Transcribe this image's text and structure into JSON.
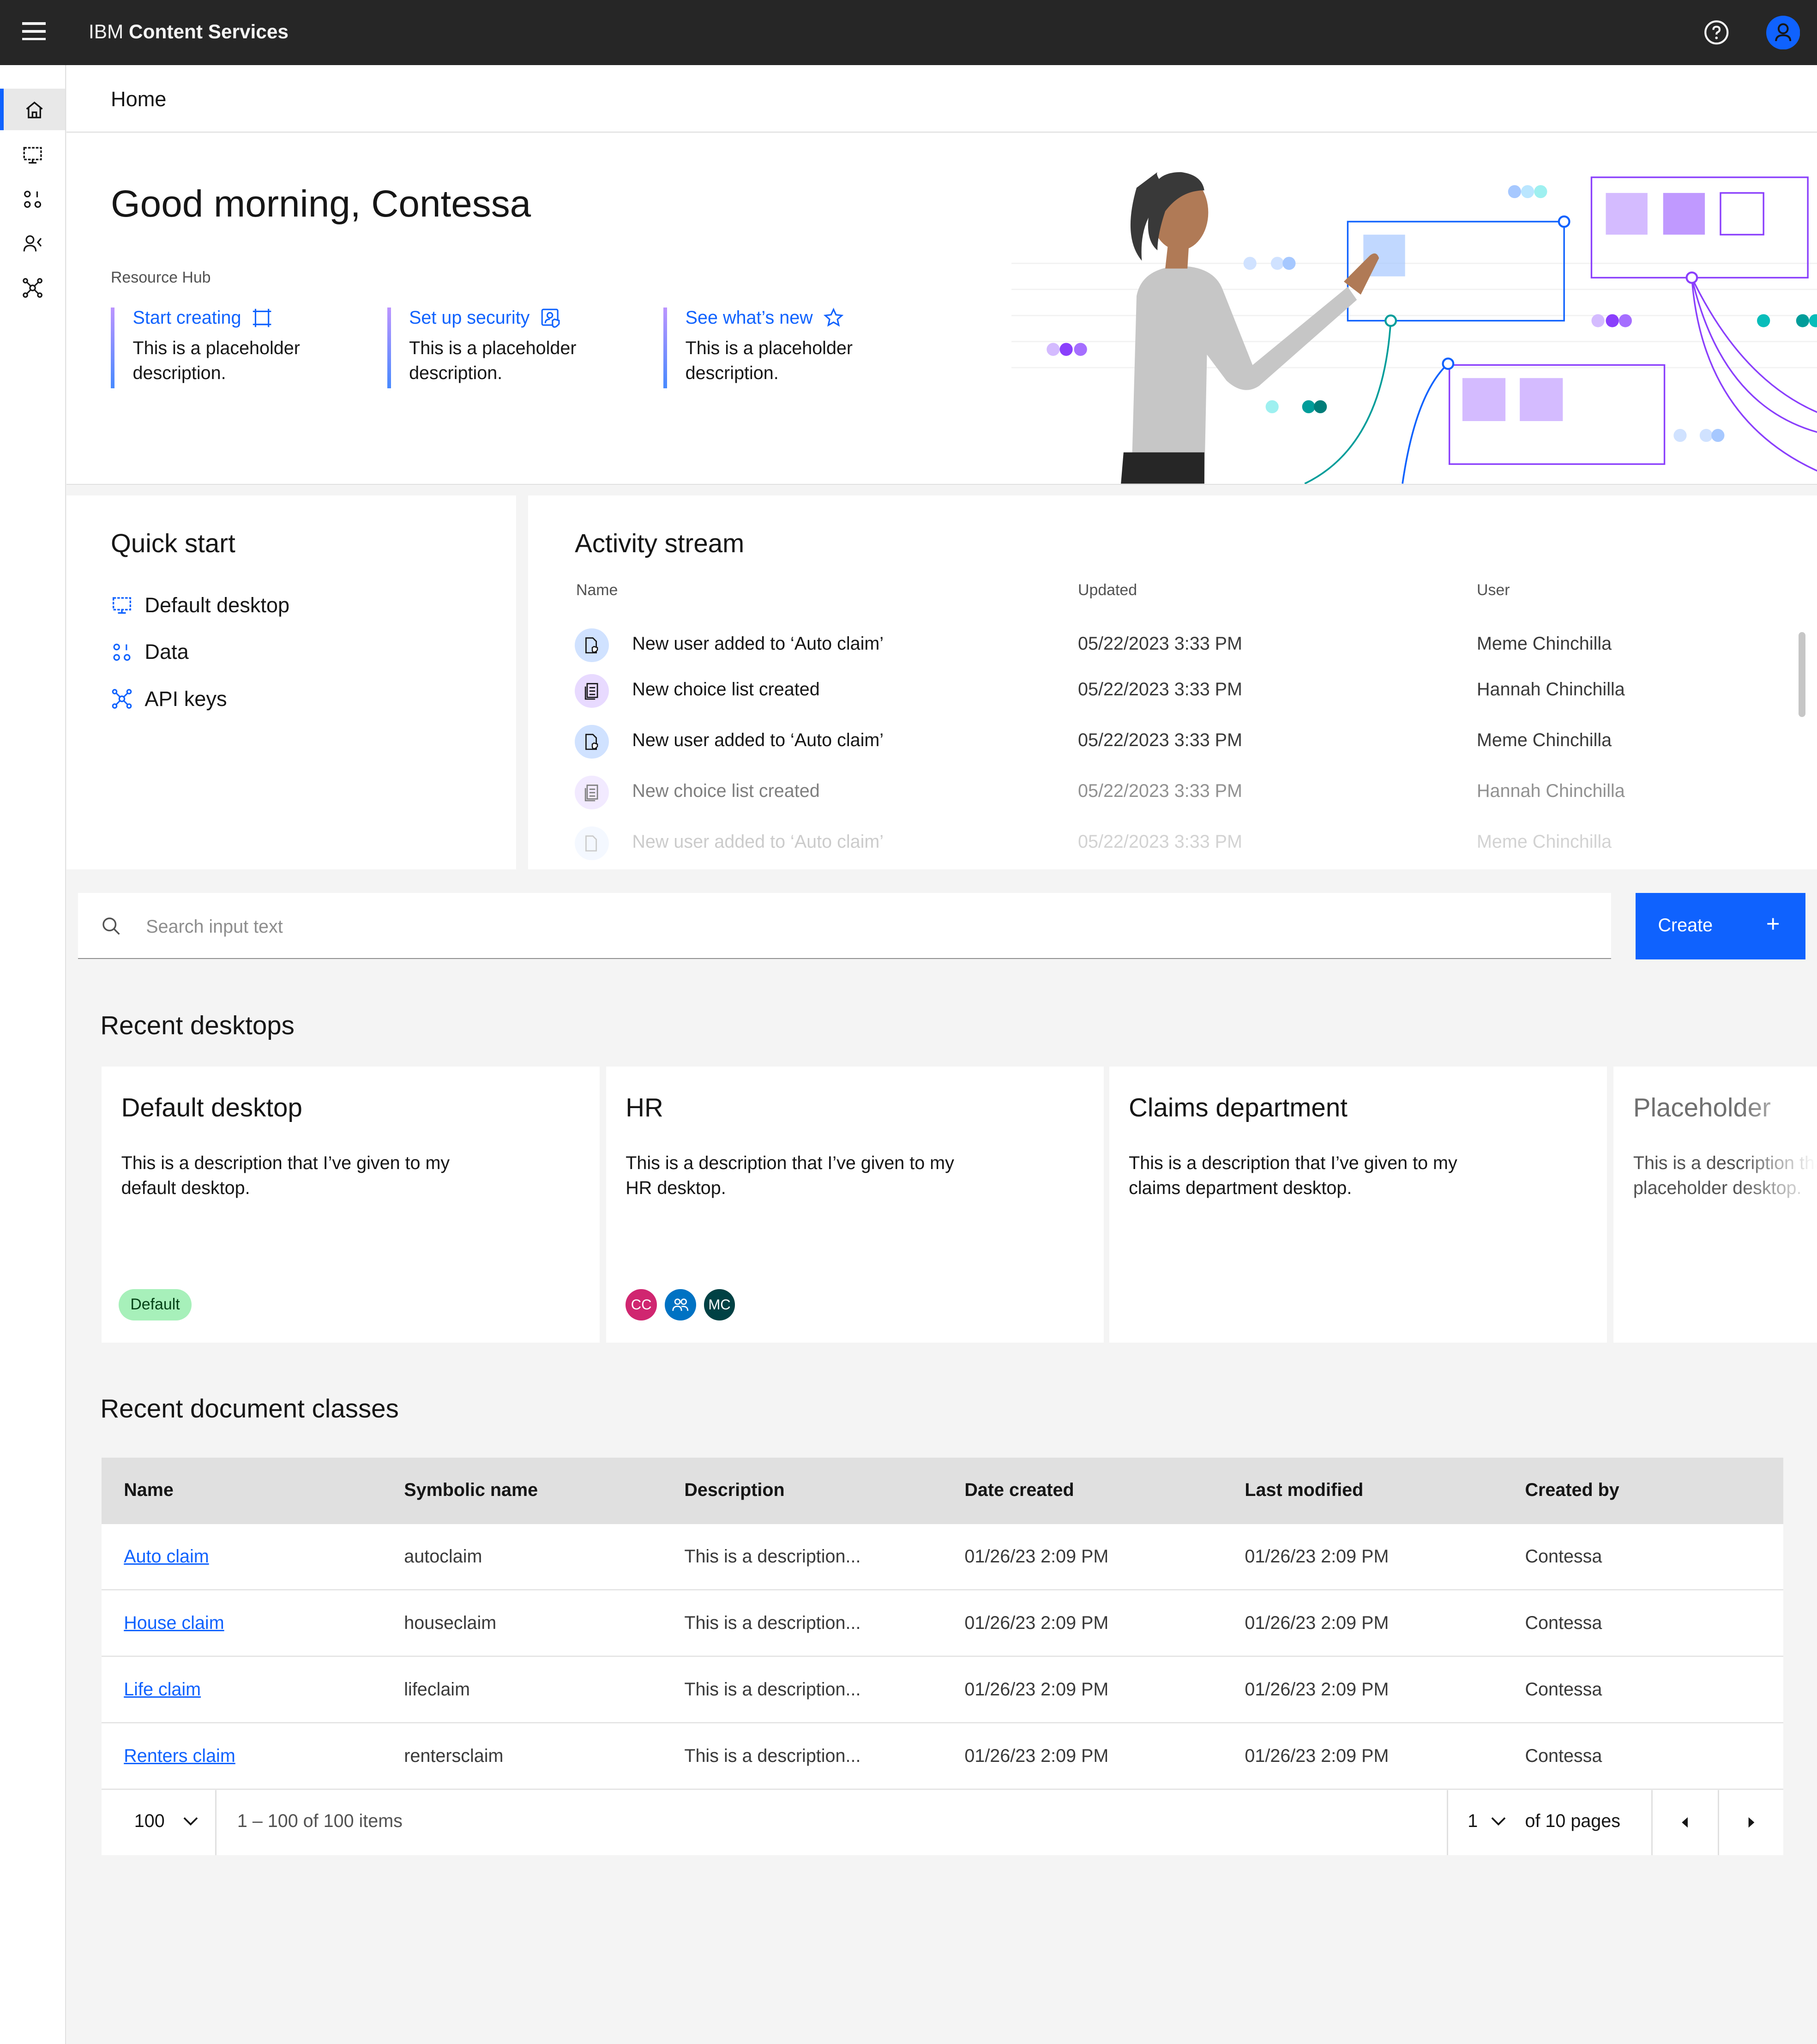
{
  "topbar": {
    "brand_prefix": "IBM",
    "brand_name": "Content Services"
  },
  "header": {
    "title": "Home"
  },
  "hero": {
    "greeting": "Good morning, Contessa",
    "hub_label": "Resource Hub",
    "resources": [
      {
        "title": "Start creating",
        "icon": "build-icon",
        "desc": "This is a placeholder description."
      },
      {
        "title": "Set up security",
        "icon": "user-security-icon",
        "desc": "This is a placeholder description."
      },
      {
        "title": "See what’s new",
        "icon": "star-icon",
        "desc": "This is a placeholder description."
      }
    ]
  },
  "quick_start": {
    "title": "Quick start",
    "items": [
      {
        "label": "Default desktop",
        "icon": "desktop-icon"
      },
      {
        "label": "Data",
        "icon": "data-icon"
      },
      {
        "label": "API keys",
        "icon": "api-icon"
      }
    ]
  },
  "activity": {
    "title": "Activity stream",
    "columns": {
      "name": "Name",
      "updated": "Updated",
      "user": "User"
    },
    "rows": [
      {
        "name": "New user added to ‘Auto claim’",
        "updated": "05/22/2023 3:33 PM",
        "user": "Meme Chinchilla",
        "icon": "document-security-icon"
      },
      {
        "name": "New choice list created",
        "updated": "05/22/2023 3:33 PM",
        "user": "Hannah Chinchilla",
        "icon": "list-document-icon"
      },
      {
        "name": "New user added to ‘Auto claim’",
        "updated": "05/22/2023 3:33 PM",
        "user": "Meme Chinchilla",
        "icon": "document-security-icon"
      },
      {
        "name": "New choice list created",
        "updated": "05/22/2023 3:33 PM",
        "user": "Hannah Chinchilla",
        "icon": "list-document-icon"
      },
      {
        "name": "New user added to ‘Auto claim’",
        "updated": "05/22/2023 3:33 PM",
        "user": "Meme Chinchilla",
        "icon": "document-security-icon"
      }
    ]
  },
  "search": {
    "placeholder": "Search input text"
  },
  "create_button": {
    "label": "Create"
  },
  "recent_desktops": {
    "title": "Recent desktops",
    "cards": [
      {
        "title": "Default desktop",
        "desc": "This is a description that I’ve given to my default desktop.",
        "tag": "Default"
      },
      {
        "title": "HR",
        "desc": "This is a description that I’ve given to my HR desktop.",
        "avatars": [
          "CC",
          "group-icon",
          "MC"
        ]
      },
      {
        "title": "Claims department",
        "desc": "This is a description that I’ve given to my claims department desktop."
      },
      {
        "title": "Placeholder",
        "desc": "This is a description that I’ve given to my placeholder desktop."
      }
    ]
  },
  "doc_classes": {
    "title": "Recent document classes",
    "columns": [
      "Name",
      "Symbolic name",
      "Description",
      "Date created",
      "Last modified",
      "Created by"
    ],
    "rows": [
      [
        "Auto claim",
        "autoclaim",
        "This is a description...",
        "01/26/23 2:09 PM",
        "01/26/23 2:09 PM",
        "Contessa"
      ],
      [
        "House claim",
        "houseclaim",
        "This is a description...",
        "01/26/23 2:09 PM",
        "01/26/23 2:09 PM",
        "Contessa"
      ],
      [
        "Life claim",
        "lifeclaim",
        "This is a description...",
        "01/26/23 2:09 PM",
        "01/26/23 2:09 PM",
        "Contessa"
      ],
      [
        "Renters claim",
        "rentersclaim",
        "This is a description...",
        "01/26/23 2:09 PM",
        "01/26/23 2:09 PM",
        "Contessa"
      ]
    ],
    "pager": {
      "page_size": "100",
      "items_text": "1 – 100 of 100 items",
      "page": "1",
      "pages_text": "of 10 pages"
    }
  },
  "colors": {
    "accent": "#0f62fe",
    "topbar": "#262626",
    "tag_bg": "#a7f0ba"
  }
}
